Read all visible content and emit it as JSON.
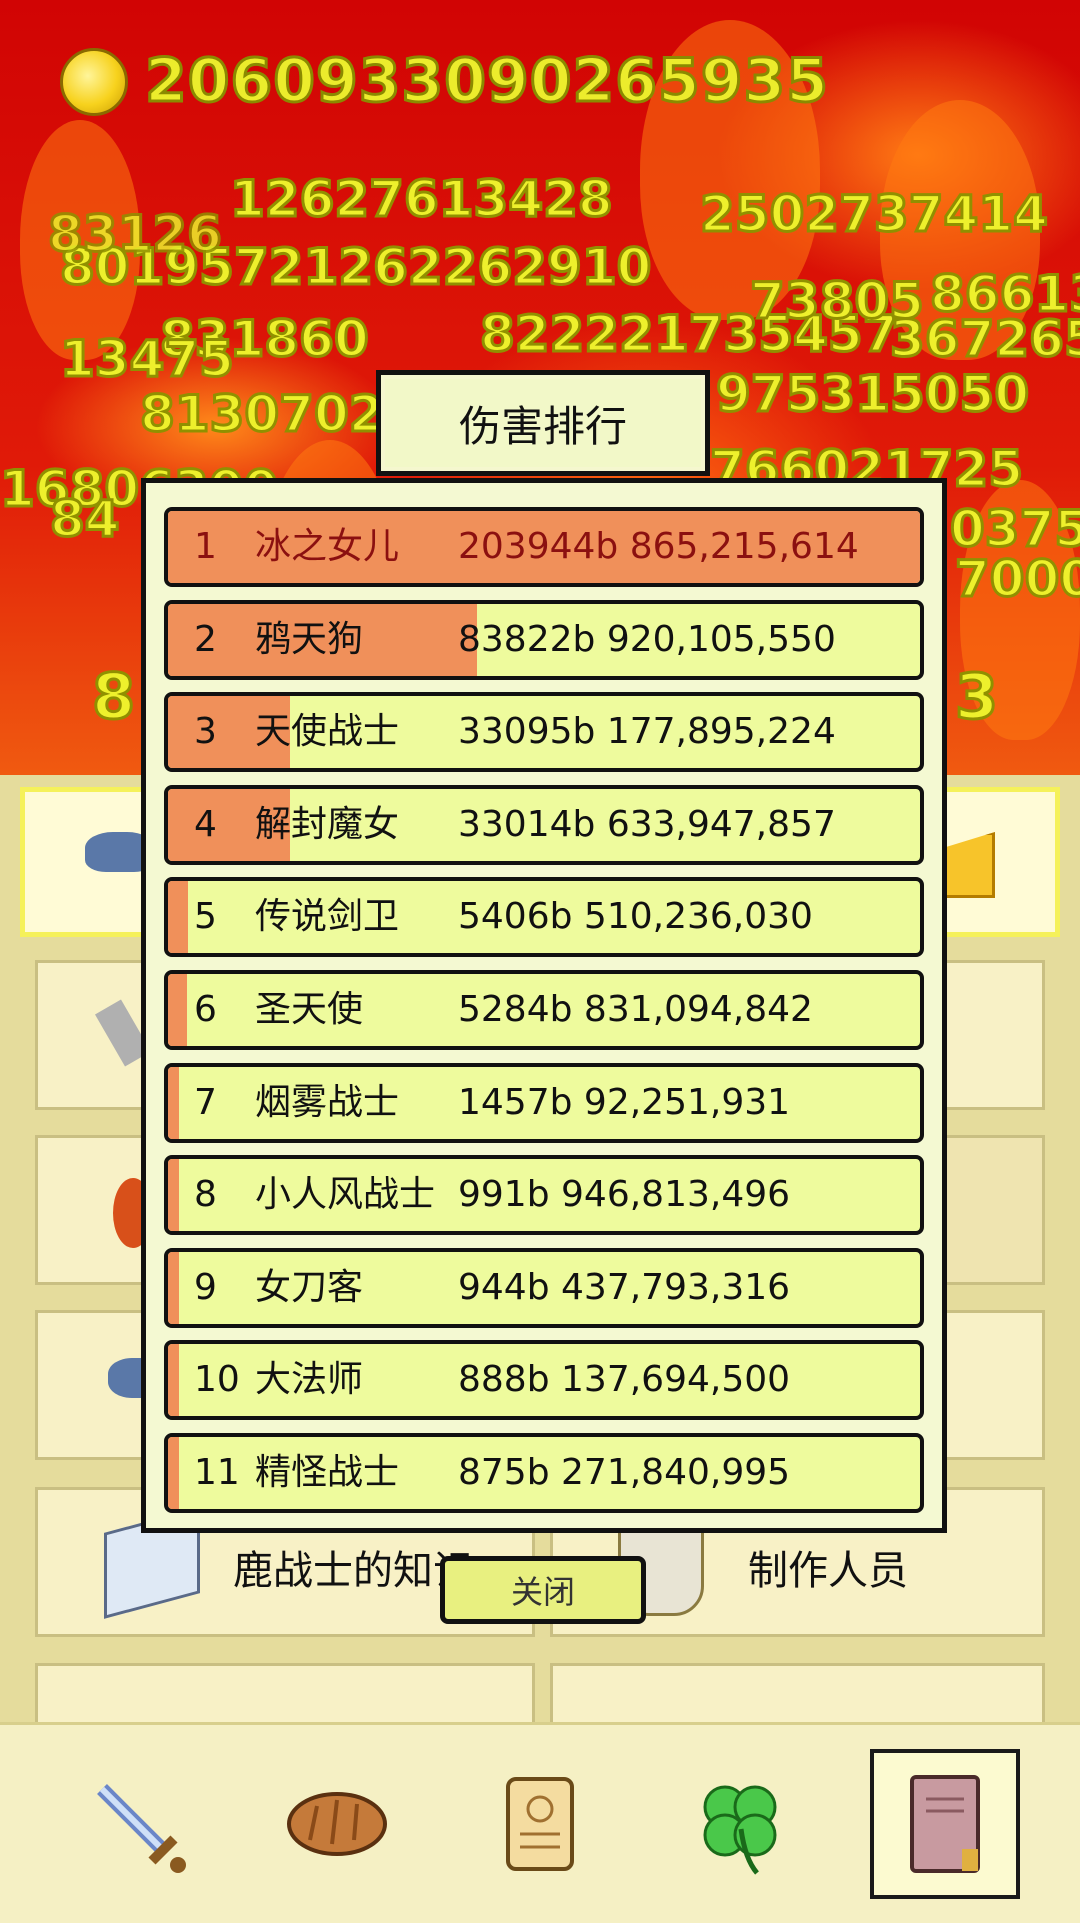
{
  "header": {
    "gold_amount": "2060933090265935"
  },
  "floating_damage": [
    "12627613428",
    "80195721262262910",
    "83126",
    "831860",
    "822221735457",
    "367265",
    "8130702",
    "16806300",
    "84",
    "8",
    "3",
    "975315050",
    "766021725",
    "0375",
    "7000",
    "13475",
    "2502737414",
    "73805",
    "86613"
  ],
  "menu": {
    "knowledge_label": "鹿战士的知识",
    "credits_label": "制作人员"
  },
  "modal": {
    "title": "伤害排行",
    "close_label": "关闭",
    "rows": [
      {
        "rank": "1",
        "name": "冰之女儿",
        "damage": "203944b 865,215,614",
        "share": 1.0
      },
      {
        "rank": "2",
        "name": "鸦天狗",
        "damage": "83822b 920,105,550",
        "share": 0.411
      },
      {
        "rank": "3",
        "name": "天使战士",
        "damage": "33095b 177,895,224",
        "share": 0.162
      },
      {
        "rank": "4",
        "name": "解封魔女",
        "damage": "33014b 633,947,857",
        "share": 0.162
      },
      {
        "rank": "5",
        "name": "传说剑卫",
        "damage": "5406b 510,236,030",
        "share": 0.0265
      },
      {
        "rank": "6",
        "name": "圣天使",
        "damage": "5284b 831,094,842",
        "share": 0.0259
      },
      {
        "rank": "7",
        "name": "烟雾战士",
        "damage": "1457b 92,251,931",
        "share": 0.0071
      },
      {
        "rank": "8",
        "name": "小人风战士",
        "damage": "991b 946,813,496",
        "share": 0.0049
      },
      {
        "rank": "9",
        "name": "女刀客",
        "damage": "944b 437,793,316",
        "share": 0.0046
      },
      {
        "rank": "10",
        "name": "大法师",
        "damage": "888b 137,694,500",
        "share": 0.0044
      },
      {
        "rank": "11",
        "name": "精怪战士",
        "damage": "875b 271,840,995",
        "share": 0.0043
      }
    ]
  },
  "tabs": [
    {
      "icon": "sword-icon"
    },
    {
      "icon": "bread-icon"
    },
    {
      "icon": "scroll-icon"
    },
    {
      "icon": "clover-icon"
    },
    {
      "icon": "book-icon",
      "active": true
    }
  ],
  "colors": {
    "bar": "#f0905a",
    "row": "#eefb9d",
    "top_text": "#8b1010"
  }
}
